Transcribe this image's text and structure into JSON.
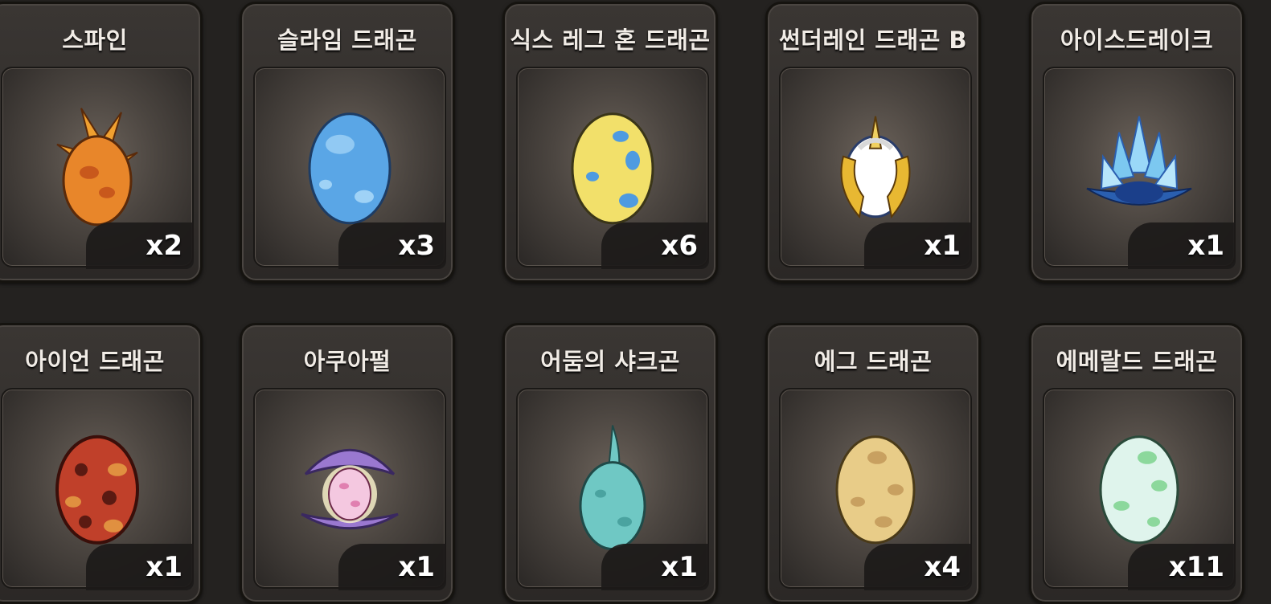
{
  "items": [
    {
      "name": "스파인",
      "qty": "x2",
      "egg_icon": "spiky-orange-egg-icon",
      "color": "#e8862a",
      "spot": "#c8581c"
    },
    {
      "name": "슬라임 드래곤",
      "qty": "x3",
      "egg_icon": "blue-slime-egg-icon",
      "color": "#5aa6e6",
      "spot": "#8fc8f4"
    },
    {
      "name": "식스 레그 혼 드래곤",
      "qty": "x6",
      "egg_icon": "yellow-spotted-egg-icon",
      "color": "#f2e06a",
      "spot": "#4e9be0"
    },
    {
      "name": "썬더레인 드래곤 B",
      "qty": "x1",
      "egg_icon": "golden-winged-egg-icon",
      "color": "#e8b832",
      "spot": "#ffffff"
    },
    {
      "name": "아이스드레이크",
      "qty": "x1",
      "egg_icon": "ice-crystal-egg-icon",
      "color": "#7cc8f0",
      "spot": "#2a5fb0"
    },
    {
      "name": "아이언 드래곤",
      "qty": "x1",
      "egg_icon": "red-iron-egg-icon",
      "color": "#c0402a",
      "spot": "#e09040"
    },
    {
      "name": "아쿠아펄",
      "qty": "x1",
      "egg_icon": "pearl-shell-egg-icon",
      "color": "#9a78d0",
      "spot": "#f0a8cc"
    },
    {
      "name": "어둠의 샤크곤",
      "qty": "x1",
      "egg_icon": "teal-fin-egg-icon",
      "color": "#6fc8c4",
      "spot": "#4aa3a0"
    },
    {
      "name": "에그 드래곤",
      "qty": "x4",
      "egg_icon": "tan-spotted-egg-icon",
      "color": "#e8cc88",
      "spot": "#c8a060"
    },
    {
      "name": "에메랄드 드래곤",
      "qty": "x11",
      "egg_icon": "emerald-spotted-egg-icon",
      "color": "#dff4ec",
      "spot": "#8cd89c"
    }
  ]
}
